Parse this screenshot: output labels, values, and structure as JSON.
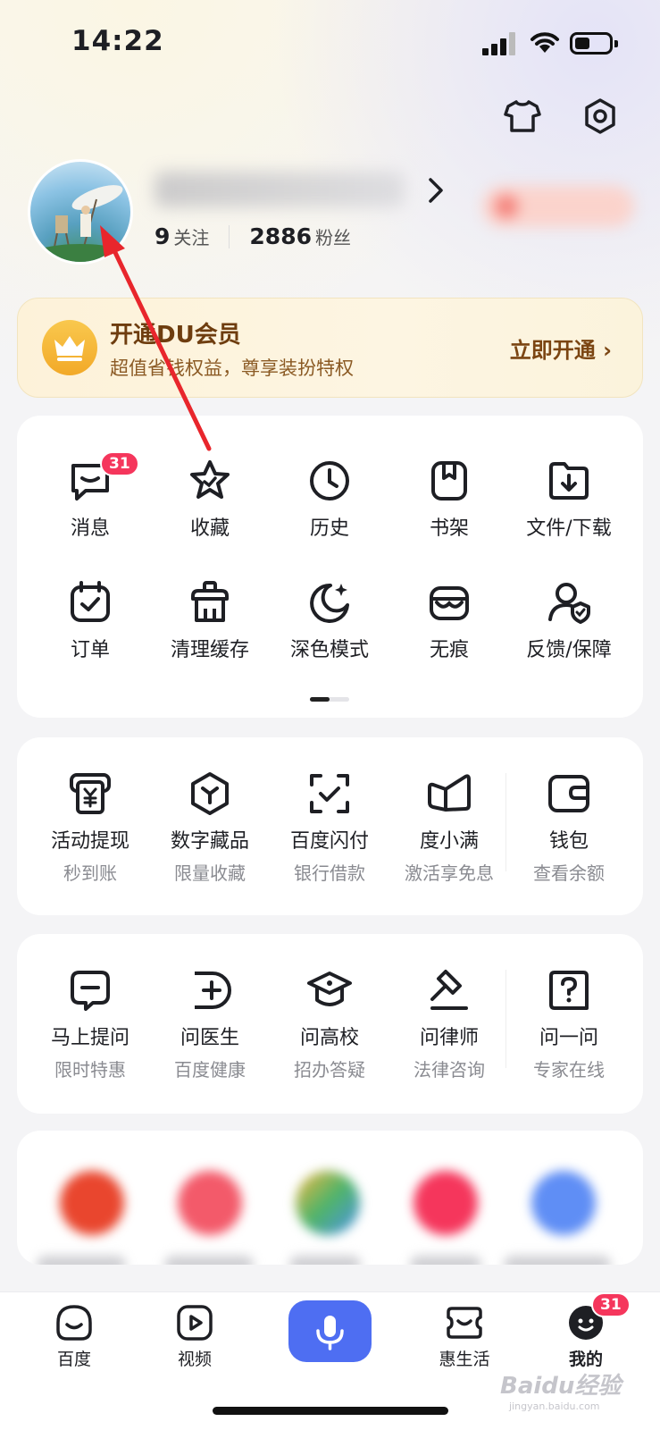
{
  "status_bar": {
    "time": "14:22"
  },
  "profile": {
    "follow_count": "9",
    "follow_label": "关注",
    "fans_count": "2886",
    "fans_label": "粉丝"
  },
  "vip": {
    "title": "开通DU会员",
    "subtitle": "超值省钱权益，尊享装扮特权",
    "cta": "立即开通 ›"
  },
  "tools": {
    "row1": [
      {
        "label": "消息",
        "icon": "message-icon",
        "badge": "31"
      },
      {
        "label": "收藏",
        "icon": "star-icon"
      },
      {
        "label": "历史",
        "icon": "clock-icon"
      },
      {
        "label": "书架",
        "icon": "bookmark-icon"
      },
      {
        "label": "文件/下载",
        "icon": "download-folder-icon"
      }
    ],
    "row2": [
      {
        "label": "订单",
        "icon": "order-calendar-icon"
      },
      {
        "label": "清理缓存",
        "icon": "clean-cache-icon"
      },
      {
        "label": "深色模式",
        "icon": "moon-icon"
      },
      {
        "label": "无痕",
        "icon": "mask-icon"
      },
      {
        "label": "反馈/保障",
        "icon": "feedback-shield-icon"
      }
    ]
  },
  "finance": [
    {
      "label": "活动提现",
      "sub": "秒到账",
      "icon": "yuan-card-icon"
    },
    {
      "label": "数字藏品",
      "sub": "限量收藏",
      "icon": "cube-icon"
    },
    {
      "label": "百度闪付",
      "sub": "银行借款",
      "icon": "scan-check-icon"
    },
    {
      "label": "度小满",
      "sub": "激活享免息",
      "icon": "duxiaoman-icon"
    },
    {
      "label": "钱包",
      "sub": "查看余额",
      "icon": "wallet-icon"
    }
  ],
  "ask": [
    {
      "label": "马上提问",
      "sub": "限时特惠",
      "icon": "question-bubble-icon"
    },
    {
      "label": "问医生",
      "sub": "百度健康",
      "icon": "doctor-icon"
    },
    {
      "label": "问高校",
      "sub": "招办答疑",
      "icon": "graduation-cap-icon"
    },
    {
      "label": "问律师",
      "sub": "法律咨询",
      "icon": "gavel-icon"
    },
    {
      "label": "问一问",
      "sub": "专家在线",
      "icon": "ask-icon"
    }
  ],
  "tabbar": {
    "tabs": [
      {
        "label": "百度",
        "icon": "baidu-home-icon"
      },
      {
        "label": "视频",
        "icon": "video-play-icon"
      },
      {
        "label": "惠生活",
        "icon": "life-ticket-icon"
      },
      {
        "label": "我的",
        "icon": "my-face-icon"
      }
    ],
    "my_badge": "31",
    "center_icon": "microphone-icon"
  },
  "watermark": {
    "text": "Baidu经验",
    "sub": "jingyan.baidu.com"
  },
  "colors": {
    "accent": "#4e6ef2",
    "badge": "#f5365c",
    "vip_text": "#6e3d0f",
    "arrow": "#e8262c"
  }
}
